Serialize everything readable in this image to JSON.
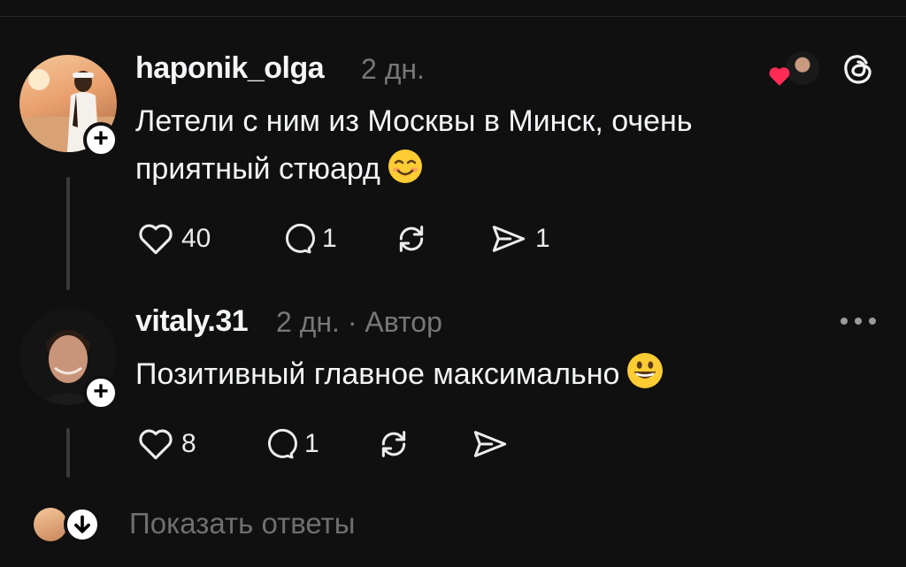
{
  "comments": [
    {
      "username": "haponik_olga",
      "time": "2 дн.",
      "text_line1": "Летели с ним из Москвы в Минск, очень",
      "text_line2": "приятный стюард",
      "likes": "40",
      "replies": "1",
      "shares": "1"
    },
    {
      "username": "vitaly.31",
      "time": "2 дн.",
      "author_badge": "· Автор",
      "text": "Позитивный главное максимально",
      "likes": "8",
      "replies": "1"
    }
  ],
  "show_replies_label": "Показать ответы",
  "colors": {
    "background": "#101010",
    "text": "#f3f5f7",
    "muted": "#777777",
    "heart": "#ff2b55"
  }
}
